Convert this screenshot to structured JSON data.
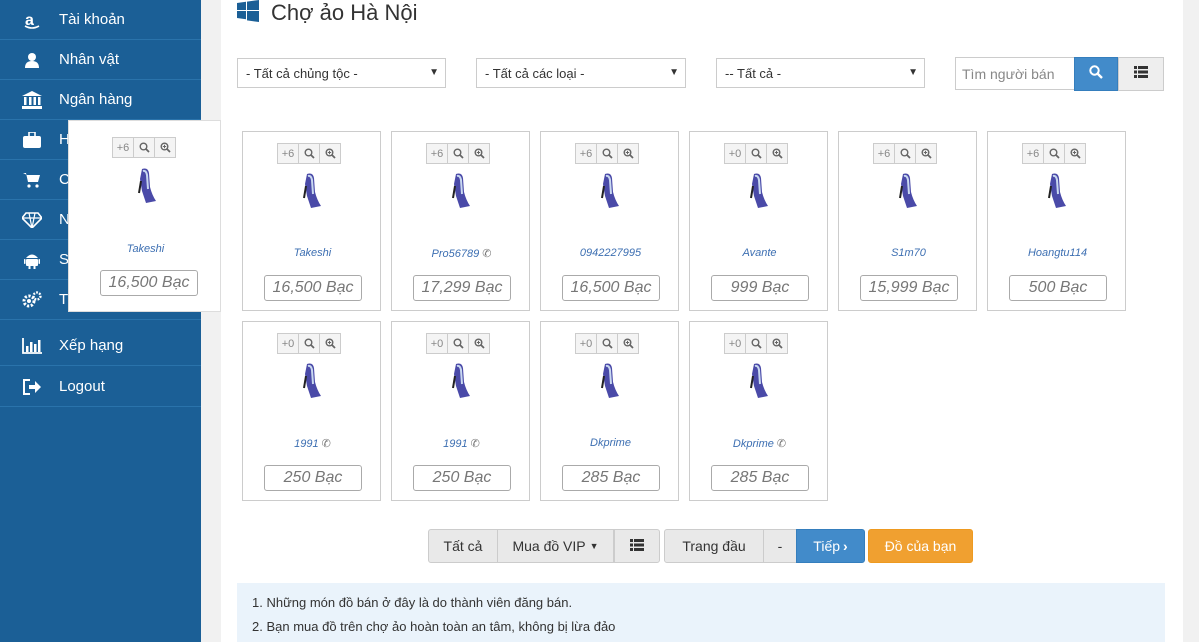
{
  "sidebar": {
    "items": [
      {
        "label": "Tài khoản",
        "icon": "amazon-icon"
      },
      {
        "label": "Nhân vật",
        "icon": "user-icon"
      },
      {
        "label": "Ngân hàng",
        "icon": "bank-icon"
      },
      {
        "label": "H",
        "icon": "briefcase-icon"
      },
      {
        "label": "C",
        "icon": "cart-icon"
      },
      {
        "label": "N",
        "icon": "diamond-icon"
      },
      {
        "label": "S",
        "icon": "android-icon"
      },
      {
        "label": "T",
        "icon": "gears-icon"
      },
      {
        "label": "Xếp hạng",
        "icon": "bar-chart-icon"
      },
      {
        "label": "Logout",
        "icon": "sign-out-icon"
      }
    ]
  },
  "header": {
    "title": "Chợ ảo Hà Nội"
  },
  "filters": {
    "race": "- Tất cả chủng tộc -",
    "type": "- Tất cả các loại -",
    "other": "-- Tất cả -",
    "search_placeholder": "Tìm người bán"
  },
  "items": [
    {
      "level": "+6",
      "seller": "Takeshi",
      "phone": false,
      "price": "16,500 Bạc"
    },
    {
      "level": "+6",
      "seller": "Pro56789",
      "phone": true,
      "price": "17,299 Bạc"
    },
    {
      "level": "+6",
      "seller": "0942227995",
      "phone": false,
      "price": "16,500 Bạc"
    },
    {
      "level": "+0",
      "seller": "Avante",
      "phone": false,
      "price": "999 Bạc"
    },
    {
      "level": "+6",
      "seller": "S1m70",
      "phone": false,
      "price": "15,999 Bạc"
    },
    {
      "level": "+6",
      "seller": "Hoangtu114",
      "phone": false,
      "price": "500 Bạc"
    },
    {
      "level": "+0",
      "seller": "1991",
      "phone": true,
      "price": "250 Bạc"
    },
    {
      "level": "+0",
      "seller": "1991",
      "phone": true,
      "price": "250 Bạc"
    },
    {
      "level": "+0",
      "seller": "Dkprime",
      "phone": false,
      "price": "285 Bạc"
    },
    {
      "level": "+0",
      "seller": "Dkprime",
      "phone": true,
      "price": "285 Bạc"
    }
  ],
  "hover_card": {
    "level": "+6",
    "seller": "Takeshi",
    "price": "16,500 Bạc"
  },
  "pagination": {
    "all": "Tất cả",
    "vip": "Mua đồ VIP",
    "first": "Trang đầu",
    "dash": "-",
    "next": "Tiếp",
    "yours": "Đồ của bạn"
  },
  "notes": [
    "1. Những món đồ bán ở đây là do thành viên đăng bán.",
    "2. Bạn mua đồ trên chợ ảo hoàn toàn an tâm, không bị lừa đảo"
  ],
  "colors": {
    "sidebar": "#1b5f96",
    "primary": "#428bca",
    "orange": "#f0a030",
    "link": "#3d6fb2"
  }
}
